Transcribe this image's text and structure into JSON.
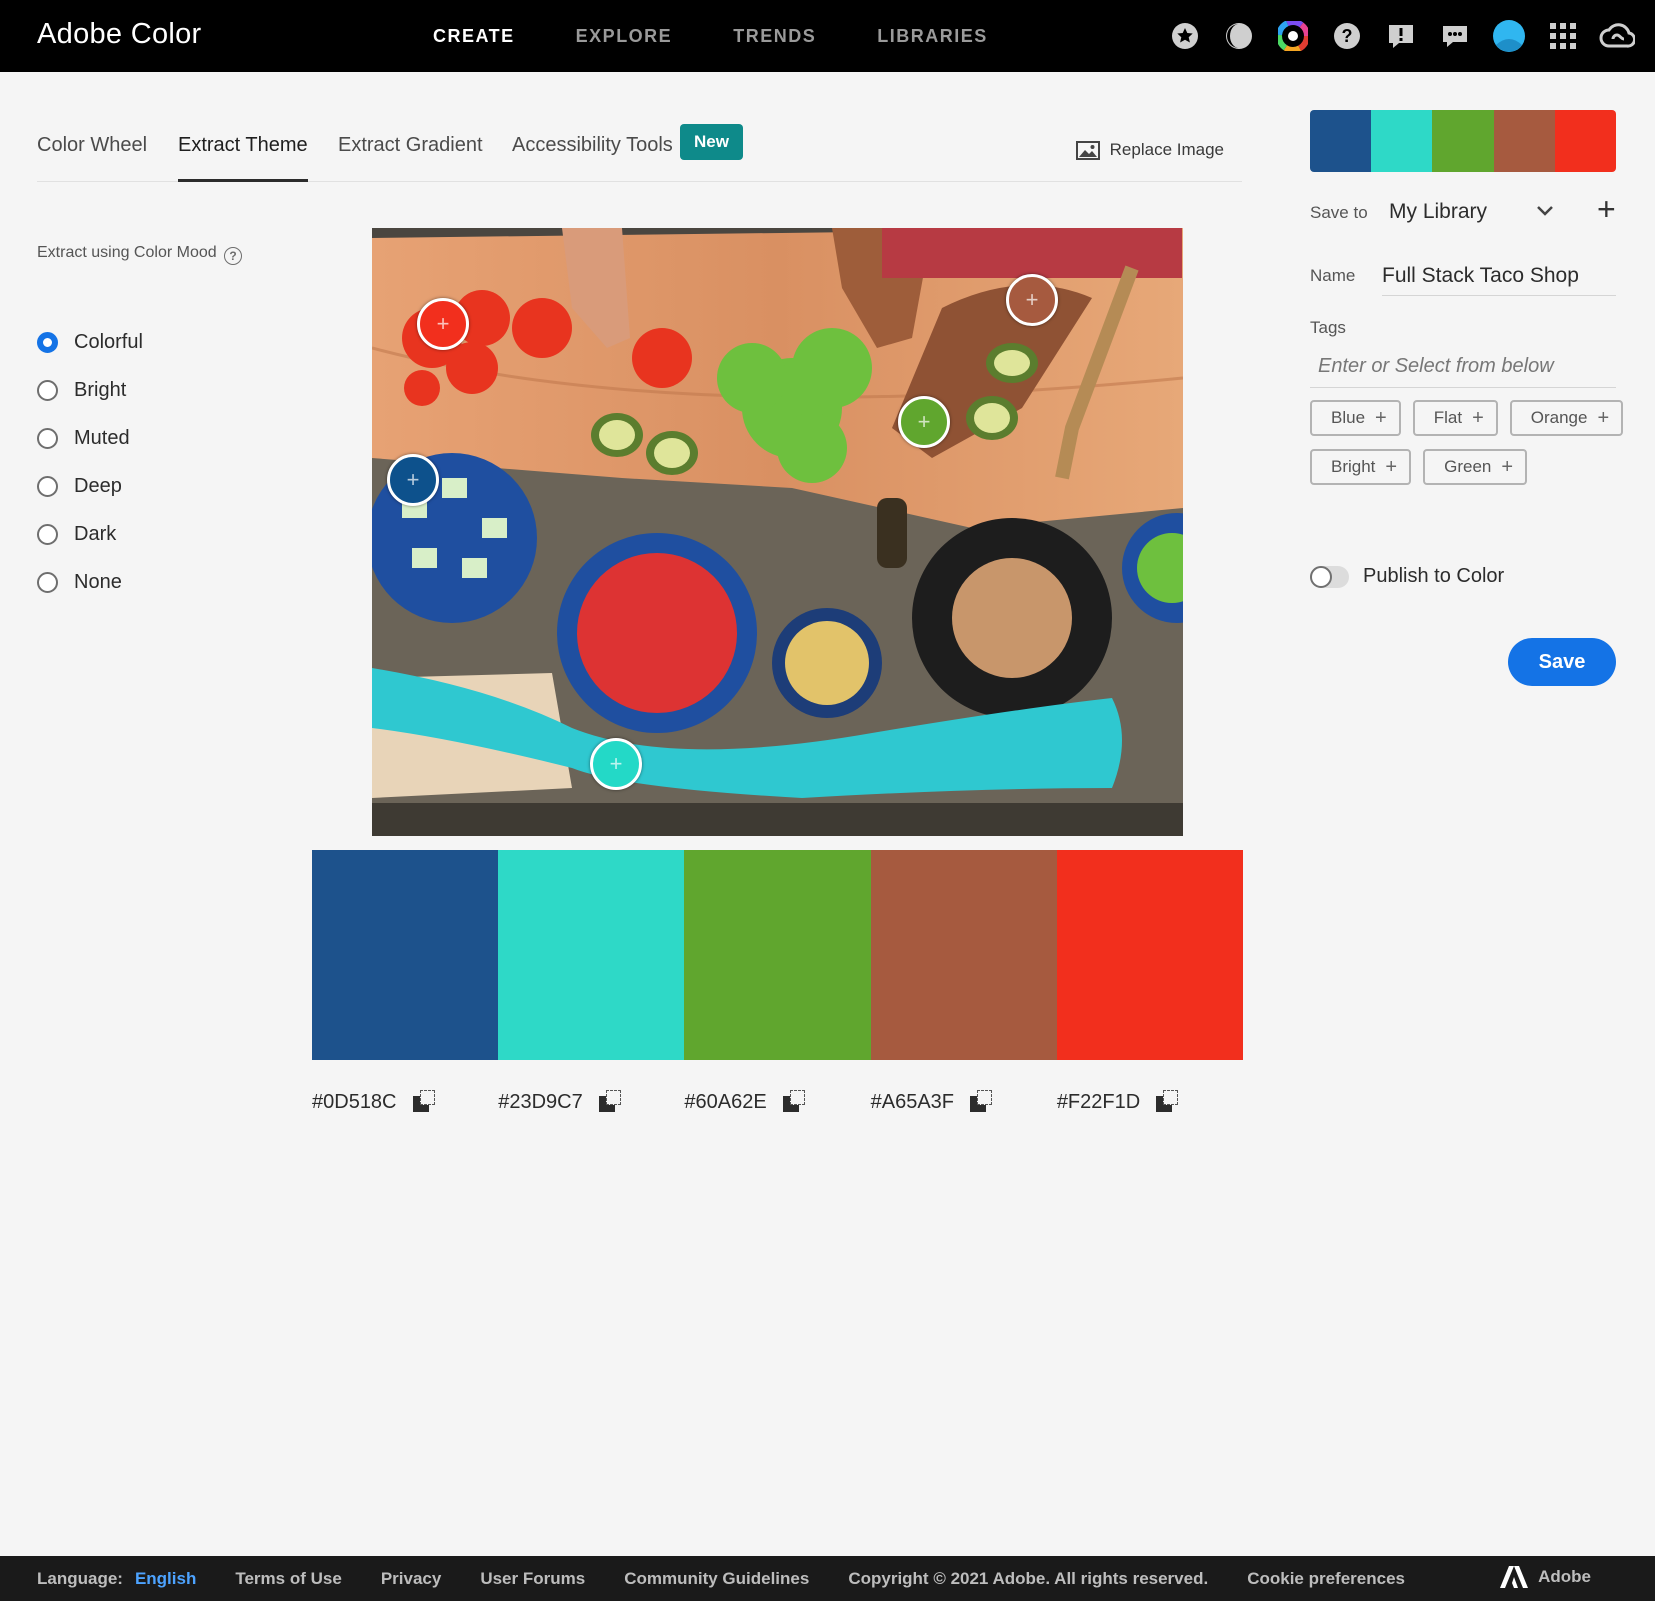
{
  "header": {
    "brand": "Adobe Color",
    "nav": [
      {
        "label": "CREATE",
        "active": true
      },
      {
        "label": "EXPLORE",
        "active": false
      },
      {
        "label": "TRENDS",
        "active": false
      },
      {
        "label": "LIBRARIES",
        "active": false
      }
    ],
    "icons": [
      "star-icon",
      "moon-icon",
      "color-wheel-icon",
      "help-icon",
      "feedback-icon",
      "chat-icon",
      "avatar",
      "apps-grid-icon",
      "creative-cloud-icon"
    ]
  },
  "tabs": {
    "items": [
      {
        "label": "Color Wheel",
        "active": false
      },
      {
        "label": "Extract Theme",
        "active": true
      },
      {
        "label": "Extract Gradient",
        "active": false
      },
      {
        "label": "Accessibility Tools",
        "active": false
      }
    ],
    "new_badge": "New",
    "replace_image": "Replace Image"
  },
  "mood_panel": {
    "title": "Extract using Color Mood",
    "options": [
      {
        "label": "Colorful",
        "checked": true
      },
      {
        "label": "Bright",
        "checked": false
      },
      {
        "label": "Muted",
        "checked": false
      },
      {
        "label": "Deep",
        "checked": false
      },
      {
        "label": "Dark",
        "checked": false
      },
      {
        "label": "None",
        "checked": false
      }
    ]
  },
  "palette": {
    "swatches": [
      {
        "hex": "#0D518C",
        "color": "#1D528C"
      },
      {
        "hex": "#23D9C7",
        "color": "#2ED9C7"
      },
      {
        "hex": "#60A62E",
        "color": "#60A62E"
      },
      {
        "hex": "#A65A3F",
        "color": "#A65A3F"
      },
      {
        "hex": "#F22F1D",
        "color": "#F22F1D"
      }
    ]
  },
  "right_panel": {
    "save_to_label": "Save to",
    "save_to_value": "My Library",
    "name_label": "Name",
    "name_value": "Full Stack Taco Shop",
    "tags_label": "Tags",
    "tags_placeholder": "Enter or Select from below",
    "tag_chips": [
      "Blue",
      "Flat",
      "Orange",
      "Bright",
      "Green"
    ],
    "publish_label": "Publish to Color",
    "publish_on": false,
    "save_button": "Save"
  },
  "footer": {
    "language_label": "Language:",
    "language_value": "English",
    "links": [
      "Terms of Use",
      "Privacy",
      "User Forums",
      "Community Guidelines"
    ],
    "copyright": "Copyright © 2021 Adobe. All rights reserved.",
    "cookie": "Cookie preferences",
    "adobe": "Adobe"
  }
}
